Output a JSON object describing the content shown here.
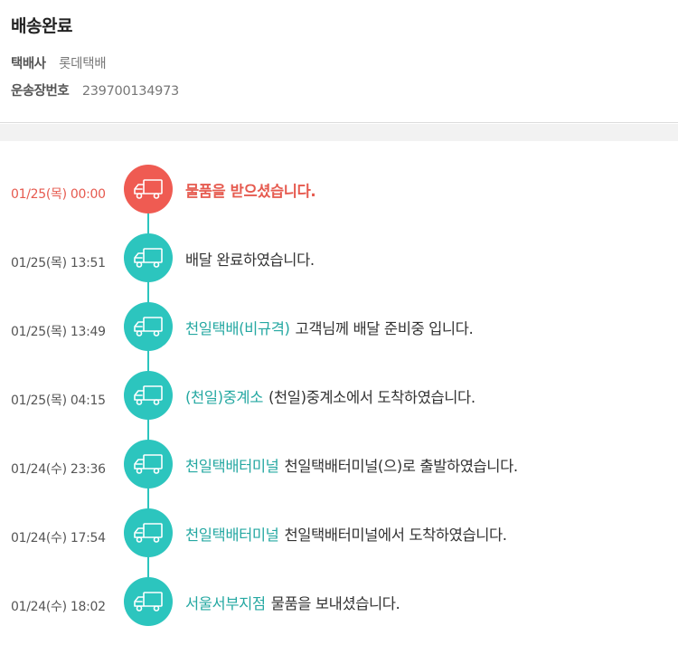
{
  "header": {
    "title": "배송완료",
    "carrier_label": "택배사",
    "carrier_value": "롯데택배",
    "tracking_label": "운송장번호",
    "tracking_value": "239700134973"
  },
  "colors": {
    "accent_teal": "#2cc5be",
    "highlight_red": "#ef5b52",
    "location_text": "#25a8a2"
  },
  "events": [
    {
      "time": "01/25(목) 00:00",
      "location": "",
      "message": "물품을 받으셨습니다.",
      "icon": "delivery-truck-icon"
    },
    {
      "time": "01/25(목) 13:51",
      "location": "",
      "message": "배달 완료하였습니다.",
      "icon": "delivery-truck-icon"
    },
    {
      "time": "01/25(목) 13:49",
      "location": "천일택배(비규격)",
      "message": "고객님께 배달 준비중 입니다.",
      "icon": "delivery-truck-icon"
    },
    {
      "time": "01/25(목) 04:15",
      "location": "(천일)중계소",
      "message": "(천일)중계소에서 도착하였습니다.",
      "icon": "delivery-truck-icon"
    },
    {
      "time": "01/24(수) 23:36",
      "location": "천일택배터미널",
      "message": "천일택배터미널(으)로 출발하였습니다.",
      "icon": "delivery-truck-icon"
    },
    {
      "time": "01/24(수) 17:54",
      "location": "천일택배터미널",
      "message": "천일택배터미널에서 도착하였습니다.",
      "icon": "delivery-truck-icon"
    },
    {
      "time": "01/24(수) 18:02",
      "location": "서울서부지점",
      "message": "물품을 보내셨습니다.",
      "icon": "delivery-truck-icon"
    }
  ]
}
